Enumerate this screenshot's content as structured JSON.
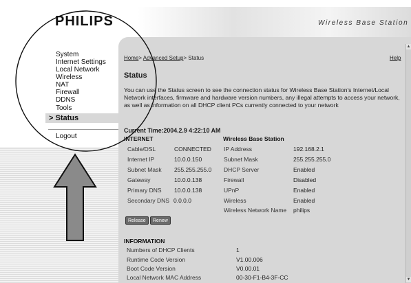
{
  "header": {
    "brand": "PHILIPS",
    "product": "Wireless Base Station"
  },
  "nav": {
    "items": [
      "System",
      "Internet Settings",
      "Local Network",
      "Wireless",
      "NAT",
      "Firewall",
      "DDNS",
      "Tools"
    ],
    "active": "> Status",
    "logout": "Logout"
  },
  "breadcrumb": {
    "home": "Home",
    "sep1": ">",
    "advanced": "Advanced Setup",
    "sep2": ">",
    "current": "Status"
  },
  "help": "Help",
  "page_title": "Status",
  "description": "You can use the Status screen to see the connection status for Wireless Base Station's Internet/Local Network interfaces, firmware and hardware version numbers, any illegal attempts to access your network, as well as information on all DHCP client PCs currently connected to your network",
  "current_time": "Current Time:2004.2.9 4:22:10 AM",
  "internet": {
    "heading": "INTERNET",
    "rows": [
      {
        "label": "Cable/DSL",
        "value": "CONNECTED"
      },
      {
        "label": "Internet IP",
        "value": "10.0.0.150"
      },
      {
        "label": "Subnet Mask",
        "value": "255.255.255.0"
      },
      {
        "label": "Gateway",
        "value": "10.0.0.138"
      },
      {
        "label": "Primary DNS",
        "value": "10.0.0.138"
      },
      {
        "label": "Secondary DNS",
        "value": "0.0.0.0"
      }
    ]
  },
  "wireless_base": {
    "heading": "Wireless Base Station",
    "rows": [
      {
        "label": "IP Address",
        "value": "192.168.2.1"
      },
      {
        "label": "Subnet Mask",
        "value": "255.255.255.0"
      },
      {
        "label": "DHCP Server",
        "value": "Enabled"
      },
      {
        "label": "Firewall",
        "value": "Disabled"
      },
      {
        "label": "UPnP",
        "value": "Enabled"
      },
      {
        "label": "Wireless",
        "value": "Enabled"
      },
      {
        "label": "Wireless Network Name",
        "value": "philips"
      }
    ]
  },
  "buttons": {
    "release": "Release",
    "renew": "Renew"
  },
  "information": {
    "heading": "INFORMATION",
    "rows": [
      {
        "label": "Numbers of DHCP Clients",
        "value": "1"
      },
      {
        "label": "Runtime Code Version",
        "value": "V1.00.006"
      },
      {
        "label": "Boot Code Version",
        "value": "V0.00.01"
      },
      {
        "label": "Local Network MAC Address",
        "value": "00-30-F1-B4-3F-CC"
      }
    ]
  },
  "colors": {
    "panel": "#d7d7d7",
    "button": "#6a6a6a"
  },
  "icons": {
    "scroll_up": "▲",
    "scroll_down": "▼"
  }
}
